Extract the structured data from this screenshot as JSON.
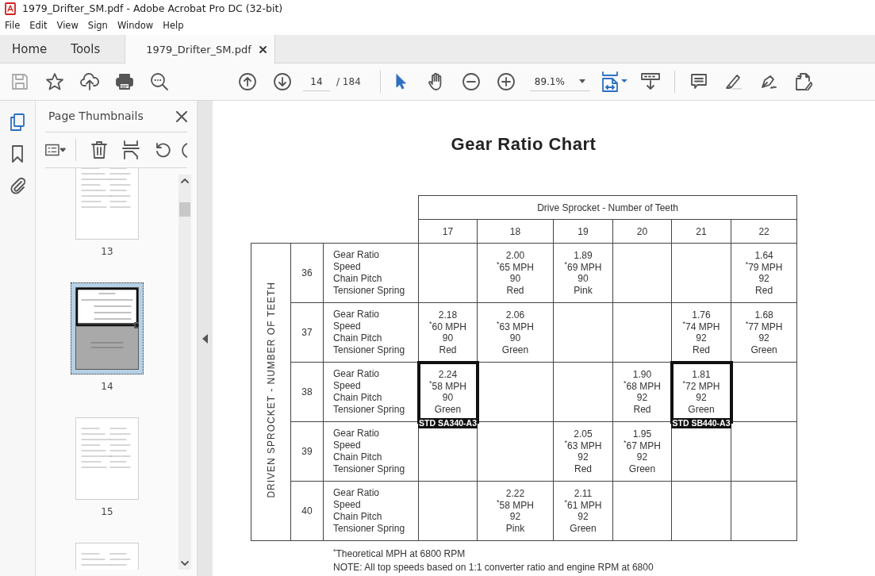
{
  "window": {
    "title": "1979_Drifter_SM.pdf - Adobe Acrobat Pro DC (32-bit)"
  },
  "menu": [
    "File",
    "Edit",
    "View",
    "Sign",
    "Window",
    "Help"
  ],
  "tabs": [
    {
      "label": "Home",
      "selected": false
    },
    {
      "label": "Tools",
      "selected": false
    },
    {
      "label": "1979_Drifter_SM.pdf",
      "selected": true
    }
  ],
  "toolbar": {
    "page": "14",
    "page_count": "/ 184",
    "zoom": "89.1%"
  },
  "sidebar": {
    "title": "Page Thumbnails",
    "thumbnails": [
      {
        "label": "13",
        "selected": false
      },
      {
        "label": "14",
        "selected": true
      },
      {
        "label": "15",
        "selected": false
      },
      {
        "selected": false
      }
    ]
  },
  "document": {
    "title": "Gear Ratio Chart",
    "column_group": "Drive Sprocket - Number of Teeth",
    "row_group": "DRIVEN SPROCKET - NUMBER OF TEETH",
    "columns": [
      "17",
      "18",
      "19",
      "20",
      "21",
      "22"
    ],
    "rows": [
      {
        "teeth": "36",
        "labels": [
          "Gear Ratio",
          "Speed",
          "Chain Pitch",
          "Tensioner Spring"
        ],
        "cells": [
          null,
          {
            "ratio": "2.00",
            "speed": "$^{*}$65 MPH",
            "pitch": "90",
            "spring": "Red"
          },
          {
            "ratio": "1.89",
            "speed": "$^{*}$69 MPH",
            "pitch": "90",
            "spring": "Pink"
          },
          null,
          null,
          {
            "ratio": "1.64",
            "speed": "$^{*}$79 MPH",
            "pitch": "92",
            "spring": "Red"
          }
        ]
      },
      {
        "teeth": "37",
        "labels": [
          "Gear Ratio",
          "Speed",
          "Chain Pitch",
          "Tensioner Spring"
        ],
        "cells": [
          {
            "ratio": "2.18",
            "speed": "$^{*}$60 MPH",
            "pitch": "90",
            "spring": "Red"
          },
          {
            "ratio": "2.06",
            "speed": "$^{*}$63 MPH",
            "pitch": "90",
            "spring": "Green"
          },
          null,
          null,
          {
            "ratio": "1.76",
            "speed": "$^{*}$74 MPH",
            "pitch": "92",
            "spring": "Red"
          },
          {
            "ratio": "1.68",
            "speed": "$^{*}$77 MPH",
            "pitch": "92",
            "spring": "Green"
          }
        ]
      },
      {
        "teeth": "38",
        "labels": [
          "Gear Ratio",
          "Speed",
          "Chain Pitch",
          "Tensioner Spring"
        ],
        "cells": [
          {
            "ratio": "2.24",
            "speed": "$^{*}$58 MPH",
            "pitch": "90",
            "spring": "Green",
            "standard": "STD SA340-A3"
          },
          null,
          null,
          {
            "ratio": "1.90",
            "speed": "$^{*}$68 MPH",
            "pitch": "92",
            "spring": "Red"
          },
          {
            "ratio": "1.81",
            "speed": "$^{*}$72 MPH",
            "pitch": "92",
            "spring": "Green",
            "standard": "STD SB440-A3"
          },
          null
        ]
      },
      {
        "teeth": "39",
        "labels": [
          "Gear Ratio",
          "Speed",
          "Chain Pitch",
          "Tensioner Spring"
        ],
        "cells": [
          null,
          null,
          {
            "ratio": "2.05",
            "speed": "$^{*}$63 MPH",
            "pitch": "92",
            "spring": "Red"
          },
          {
            "ratio": "1.95",
            "speed": "$^{*}$67 MPH",
            "pitch": "92",
            "spring": "Green"
          },
          null,
          null
        ]
      },
      {
        "teeth": "40",
        "labels": [
          "Gear Ratio",
          "Speed",
          "Chain Pitch",
          "Tensioner Spring"
        ],
        "cells": [
          null,
          {
            "ratio": "2.22",
            "speed": "$^{*}$58 MPH",
            "pitch": "92",
            "spring": "Pink"
          },
          {
            "ratio": "2.11",
            "speed": "$^{*}$61 MPH",
            "pitch": "92",
            "spring": "Green"
          },
          null,
          null,
          null
        ]
      }
    ],
    "footnotes": [
      "$^{*}$Theoretical MPH at 6800 RPM",
      "NOTE: All top speeds based on 1:1 converter ratio and engine RPM at 6800"
    ]
  }
}
